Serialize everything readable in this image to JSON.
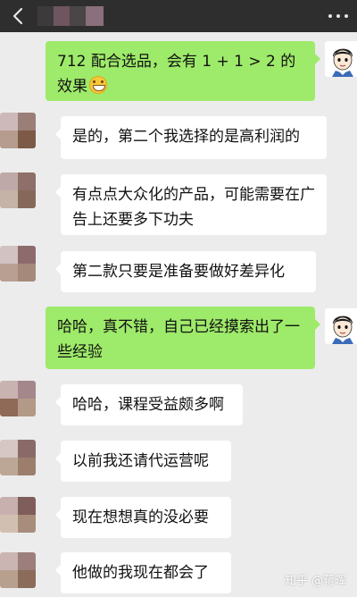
{
  "header": {
    "back_icon": "chevron-left-icon",
    "title_obscured": true,
    "more_icon": "more-dots-icon"
  },
  "messages": [
    {
      "side": "out",
      "text": "712 配合选品，会有 1 + 1 > 2 的效果",
      "emoji": "grinning-face-emoji"
    },
    {
      "side": "in",
      "text": "是的，第二个我选择的是高利润的"
    },
    {
      "side": "in",
      "text": "有点点大众化的产品，可能需要在广告上还要多下功夫"
    },
    {
      "side": "in",
      "text": "第二款只要是准备要做好差异化"
    },
    {
      "side": "out",
      "text": "哈哈，真不错，自己已经摸索出了一些经验"
    },
    {
      "side": "in",
      "text": "哈哈，课程受益颇多啊"
    },
    {
      "side": "in",
      "text": "以前我还请代运营呢"
    },
    {
      "side": "in",
      "text": "现在想想真的没必要"
    },
    {
      "side": "in",
      "text": "他做的我现在都会了"
    }
  ],
  "watermark": "知乎 @蒋晖",
  "colors": {
    "background": "#ececec",
    "titlebar": "#2e2e2e",
    "bubble_out": "#9eea6a",
    "bubble_in": "#ffffff"
  }
}
